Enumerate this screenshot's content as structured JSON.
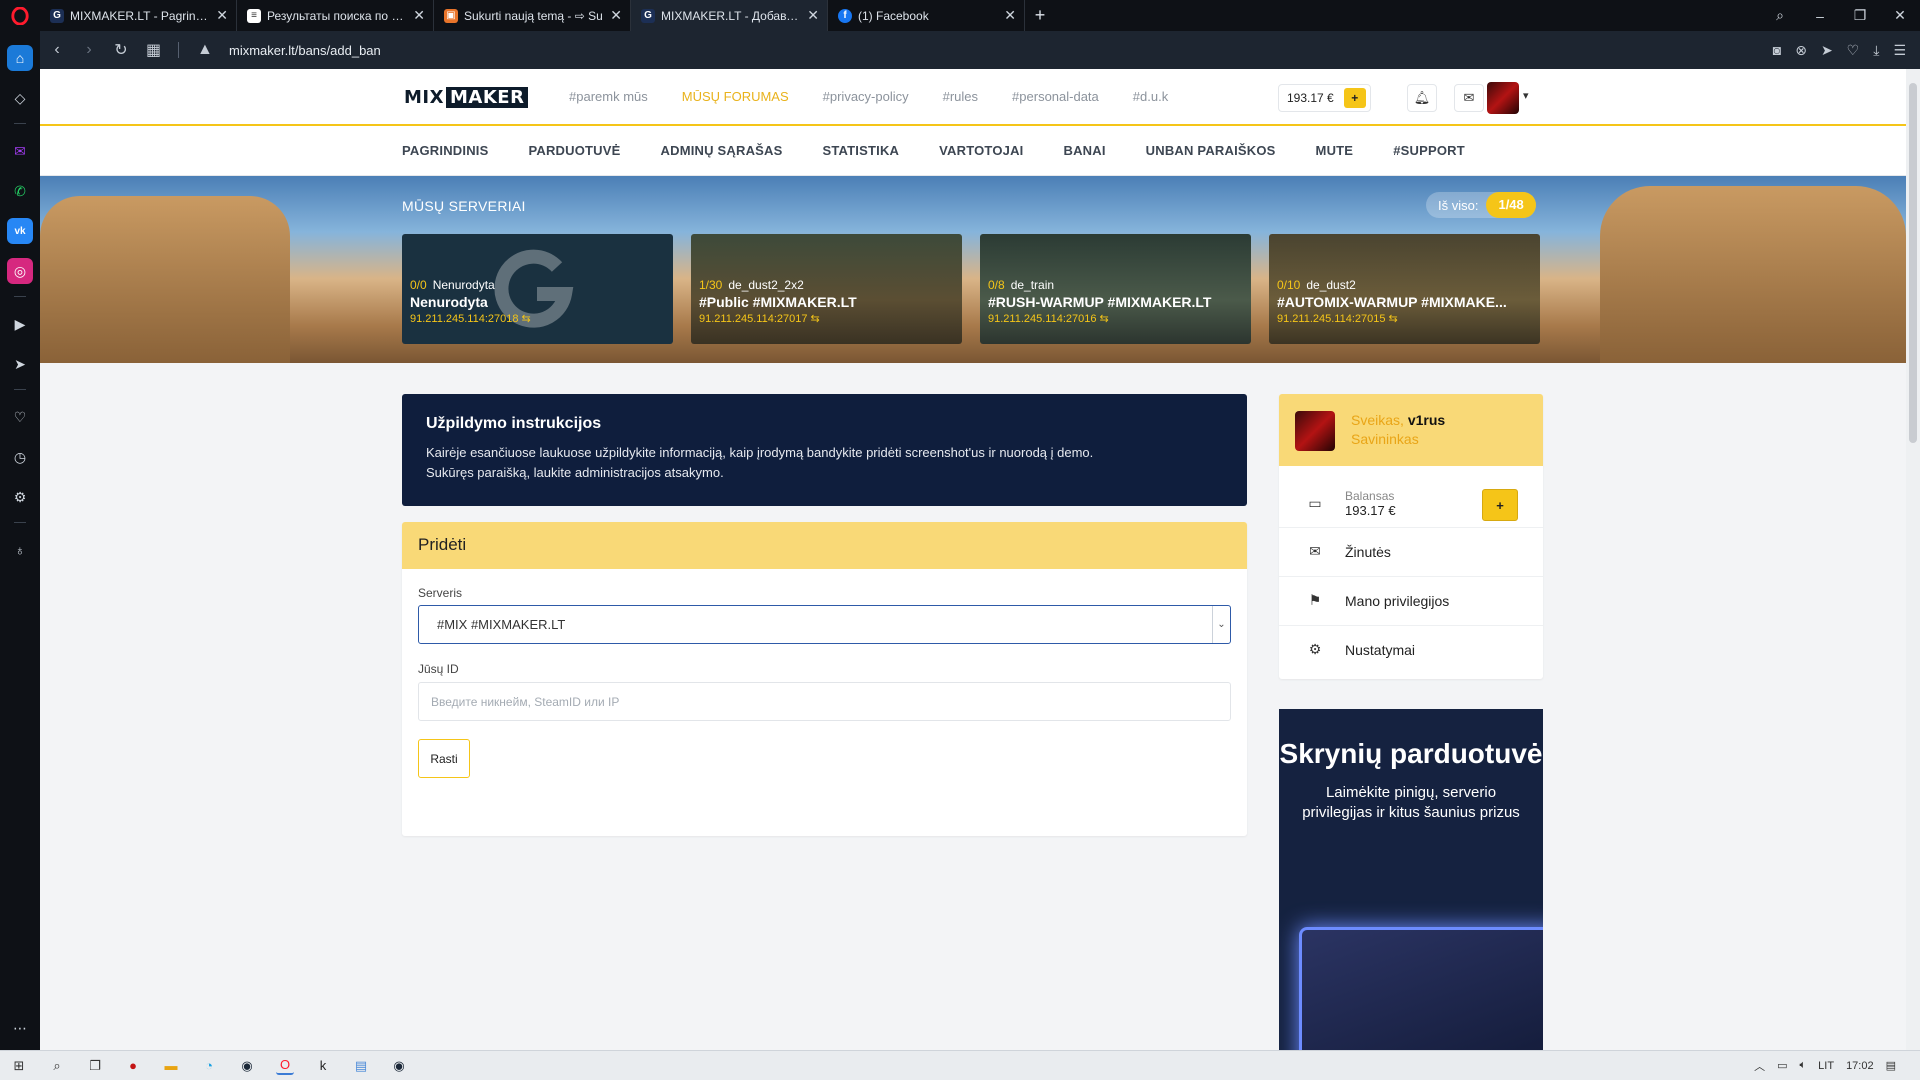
{
  "browser": {
    "tabs": [
      {
        "title": "MIXMAKER.LT - Pagrindinis",
        "favicon": "G"
      },
      {
        "title": "Результаты поиска по зап",
        "favicon": "doc"
      },
      {
        "title": "Sukurti naują temą - ⇨ Su",
        "favicon": "img"
      },
      {
        "title": "MIXMAKER.LT - Добавлени",
        "favicon": "G"
      },
      {
        "title": "(1) Facebook",
        "favicon": "f"
      }
    ],
    "active_tab": 3,
    "url": "mixmaker.lt/bans/add_ban"
  },
  "site": {
    "logo_left": "MIX",
    "logo_right": "MAKER",
    "top_links": [
      "#paremk mūs",
      "MŪSŲ FORUMAS",
      "#privacy-policy",
      "#rules",
      "#personal-data",
      "#d.u.k"
    ],
    "highlight_link_index": 1,
    "balance": "193.17 €",
    "plus": "+",
    "nav": [
      "PAGRINDINIS",
      "PARDUOTUVĖ",
      "ADMINŲ SĄRAŠAS",
      "STATISTIKA",
      "VARTOTOJAI",
      "BANAI",
      "UNBAN PARAIŠKOS",
      "MUTE",
      "#SUPPORT"
    ]
  },
  "banner": {
    "title": "MŪSŲ SERVERIAI",
    "total_label": "Iš viso:",
    "total_value": "1/48",
    "servers": [
      {
        "players": "0/0",
        "map": "Nenurodyta",
        "name": "Nenurodyta",
        "ip": "91.211.245.114:27018 ⇆"
      },
      {
        "players": "1/30",
        "map": "de_dust2_2x2",
        "name": "#Public #MIXMAKER.LT",
        "ip": "91.211.245.114:27017 ⇆"
      },
      {
        "players": "0/8",
        "map": "de_train",
        "name": "#RUSH-WARMUP #MIXMAKER.LT",
        "ip": "91.211.245.114:27016 ⇆"
      },
      {
        "players": "0/10",
        "map": "de_dust2",
        "name": "#AUTOMIX-WARMUP #MIXMAKE...",
        "ip": "91.211.245.114:27015 ⇆"
      }
    ]
  },
  "instructions": {
    "title": "Užpildymo instrukcijos",
    "line1": "Kairėje esančiuose laukuose užpildykite informaciją, kaip įrodymą bandykite pridėti screenshot'us ir nuorodą į demo.",
    "line2": "Sukūręs paraišką, laukite administracijos atsakymo."
  },
  "form": {
    "title": "Pridėti",
    "server_label": "Serveris",
    "server_value": "#MIX #MIXMAKER.LT",
    "id_label": "Jūsų ID",
    "id_placeholder": "Введите никнейм, SteamID или IP",
    "submit": "Rasti"
  },
  "profile": {
    "greeting": "Sveikas,",
    "username": "v1rus",
    "role": "Savininkas",
    "balance_caption": "Balansas",
    "balance_value": "193.17 €",
    "plus": "+",
    "menu": [
      "Žinutės",
      "Mano privilegijos",
      "Nustatymai"
    ]
  },
  "promo": {
    "title": "Skrynių parduotuvė",
    "subtitle": "Laimėkite pinigų, serverio privilegijas ir kitus šaunius prizus"
  },
  "taskbar": {
    "lang": "LIT",
    "time": "17:02"
  },
  "colors": {
    "accent": "#f5c518",
    "navy": "#0f1e3d",
    "header_highlight": "#e9b21b"
  }
}
